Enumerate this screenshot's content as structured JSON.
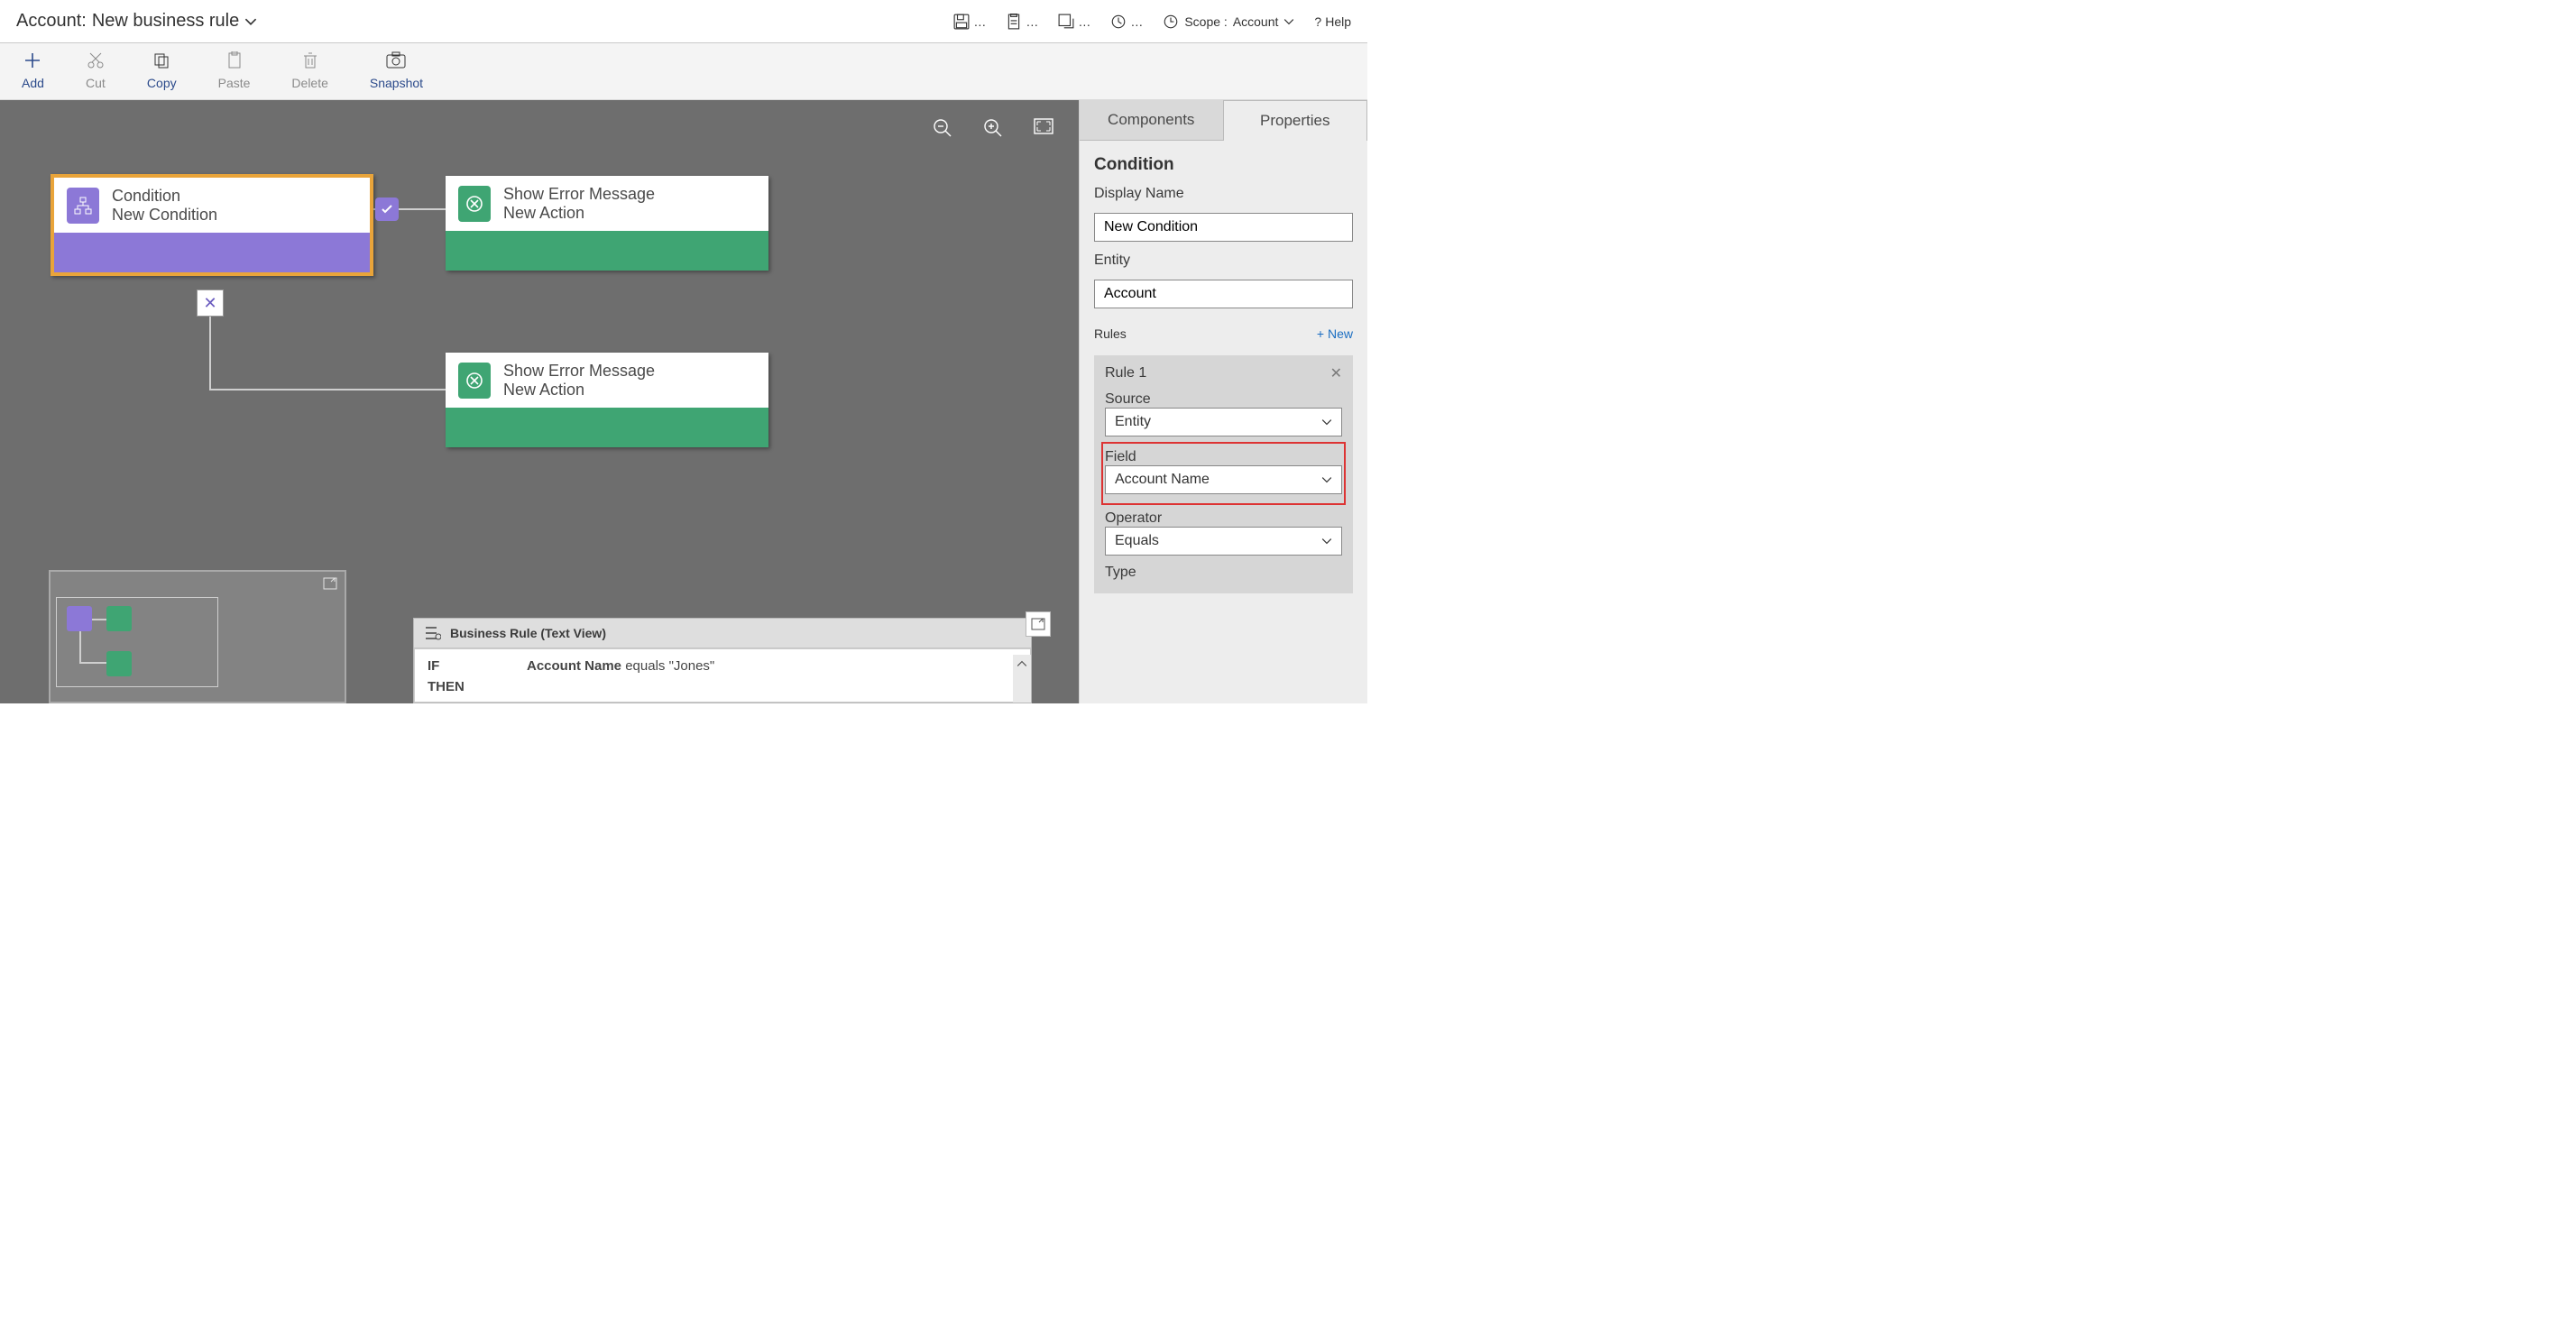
{
  "header": {
    "entity_label": "Account:",
    "rule_name": "New business rule",
    "scope_label": "Scope :",
    "scope_value": "Account",
    "help": "Help"
  },
  "toolbar": {
    "add": "Add",
    "cut": "Cut",
    "copy": "Copy",
    "paste": "Paste",
    "delete": "Delete",
    "snapshot": "Snapshot"
  },
  "canvas": {
    "condition": {
      "title": "Condition",
      "subtitle": "New Condition"
    },
    "action1": {
      "title": "Show Error Message",
      "subtitle": "New Action"
    },
    "action2": {
      "title": "Show Error Message",
      "subtitle": "New Action"
    }
  },
  "textview": {
    "heading": "Business Rule (Text View)",
    "if": "IF",
    "then": "THEN",
    "cond_field": "Account Name",
    "cond_rest": " equals \"Jones\""
  },
  "panel": {
    "tabs": {
      "components": "Components",
      "properties": "Properties"
    },
    "section_title": "Condition",
    "display_name_label": "Display Name",
    "display_name_value": "New Condition",
    "entity_label": "Entity",
    "entity_value": "Account",
    "rules_label": "Rules",
    "new_label": "+  New",
    "rule1": {
      "title": "Rule 1",
      "source_label": "Source",
      "source_value": "Entity",
      "field_label": "Field",
      "field_value": "Account Name",
      "operator_label": "Operator",
      "operator_value": "Equals",
      "type_label": "Type"
    }
  }
}
